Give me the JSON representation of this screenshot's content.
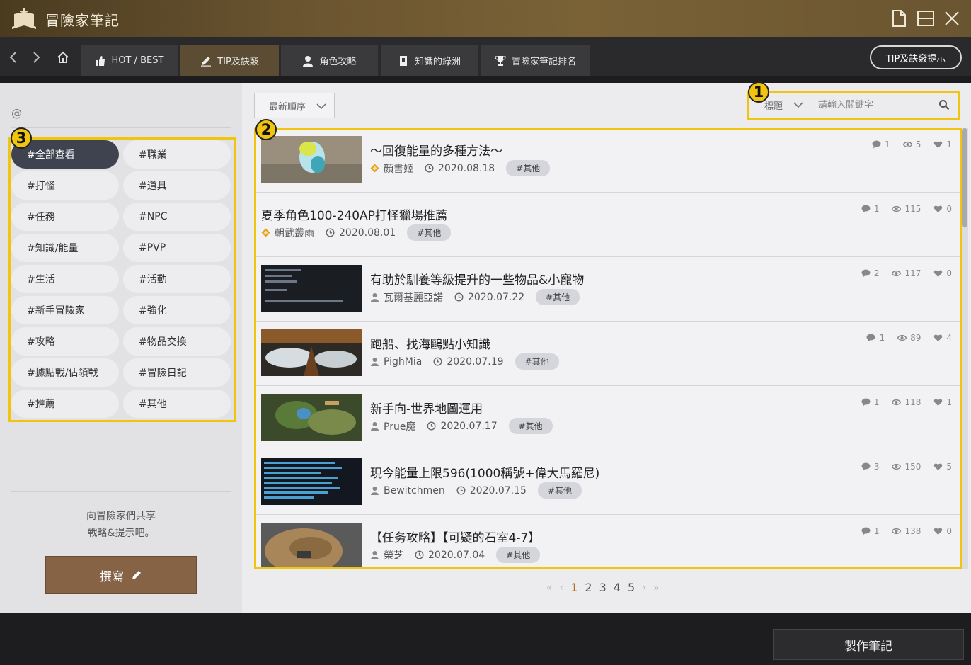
{
  "window": {
    "title": "冒險家筆記"
  },
  "nav": {
    "tabs": [
      {
        "label": "HOT / BEST",
        "icon": "thumbs-up-icon"
      },
      {
        "label": "TIP及訣竅",
        "icon": "pencil-icon"
      },
      {
        "label": "角色攻略",
        "icon": "user-icon"
      },
      {
        "label": "知識的綠洲",
        "icon": "book-icon"
      },
      {
        "label": "冒險家筆記排名",
        "icon": "trophy-icon"
      }
    ],
    "hint_button": "TIP及訣竅提示"
  },
  "sidebar": {
    "at": "@",
    "tags": [
      "#全部查看",
      "#職業",
      "#打怪",
      "#道具",
      "#任務",
      "#NPC",
      "#知識/能量",
      "#PVP",
      "#生活",
      "#活動",
      "#新手冒險家",
      "#強化",
      "#攻略",
      "#物品交換",
      "#據點戰/佔領戰",
      "#冒險日記",
      "#推薦",
      "#其他"
    ],
    "share_line1": "向冒險家們共享",
    "share_line2": "戰略&提示吧。",
    "write_button": "撰寫"
  },
  "toolbar": {
    "sort": "最新順序",
    "search_type": "標題",
    "search_placeholder": "請輸入關鍵字"
  },
  "posts": [
    {
      "title": "～回復能量的多種方法～",
      "author": "顏書姬",
      "author_icon": "diamond-icon",
      "date": "2020.08.18",
      "tag": "#其他",
      "comments": "1",
      "views": "5",
      "likes": "1"
    },
    {
      "title": "夏季角色100-240AP打怪獵場推薦",
      "author": "朝武叢雨",
      "author_icon": "diamond-icon",
      "date": "2020.08.01",
      "tag": "#其他",
      "comments": "1",
      "views": "115",
      "likes": "0"
    },
    {
      "title": "有助於馴養等級提升的一些物品&小寵物",
      "author": "瓦爾基麗亞諾",
      "author_icon": "user-icon",
      "date": "2020.07.22",
      "tag": "#其他",
      "comments": "2",
      "views": "117",
      "likes": "0"
    },
    {
      "title": "跑船、找海鷗點小知識",
      "author": "PighMia",
      "author_icon": "user-icon",
      "date": "2020.07.19",
      "tag": "#其他",
      "comments": "1",
      "views": "89",
      "likes": "4"
    },
    {
      "title": "新手向-世界地圖運用",
      "author": "Prue魔",
      "author_icon": "user-icon",
      "date": "2020.07.17",
      "tag": "#其他",
      "comments": "1",
      "views": "118",
      "likes": "1"
    },
    {
      "title": "現今能量上限596(1000稱號+偉大馬羅尼)",
      "author": "Bewitchmen",
      "author_icon": "user-icon",
      "date": "2020.07.15",
      "tag": "#其他",
      "comments": "3",
      "views": "150",
      "likes": "5"
    },
    {
      "title": "【任务攻略】【可疑的石室4-7】",
      "author": "榮芝",
      "author_icon": "user-icon",
      "date": "2020.07.04",
      "tag": "#其他",
      "comments": "1",
      "views": "138",
      "likes": "0"
    }
  ],
  "pagination": {
    "pages": [
      "1",
      "2",
      "3",
      "4",
      "5"
    ],
    "current": "1",
    "first": "«",
    "prev": "‹",
    "next": "›",
    "last": "»"
  },
  "footer": {
    "make_note": "製作筆記"
  },
  "callouts": [
    "1",
    "2",
    "3"
  ],
  "colors": {
    "highlight": "#f1c40f",
    "active_tab": "#5b4c33",
    "active_tag": "#3f4350",
    "write_button": "#876346",
    "current_page": "#b06a22"
  }
}
